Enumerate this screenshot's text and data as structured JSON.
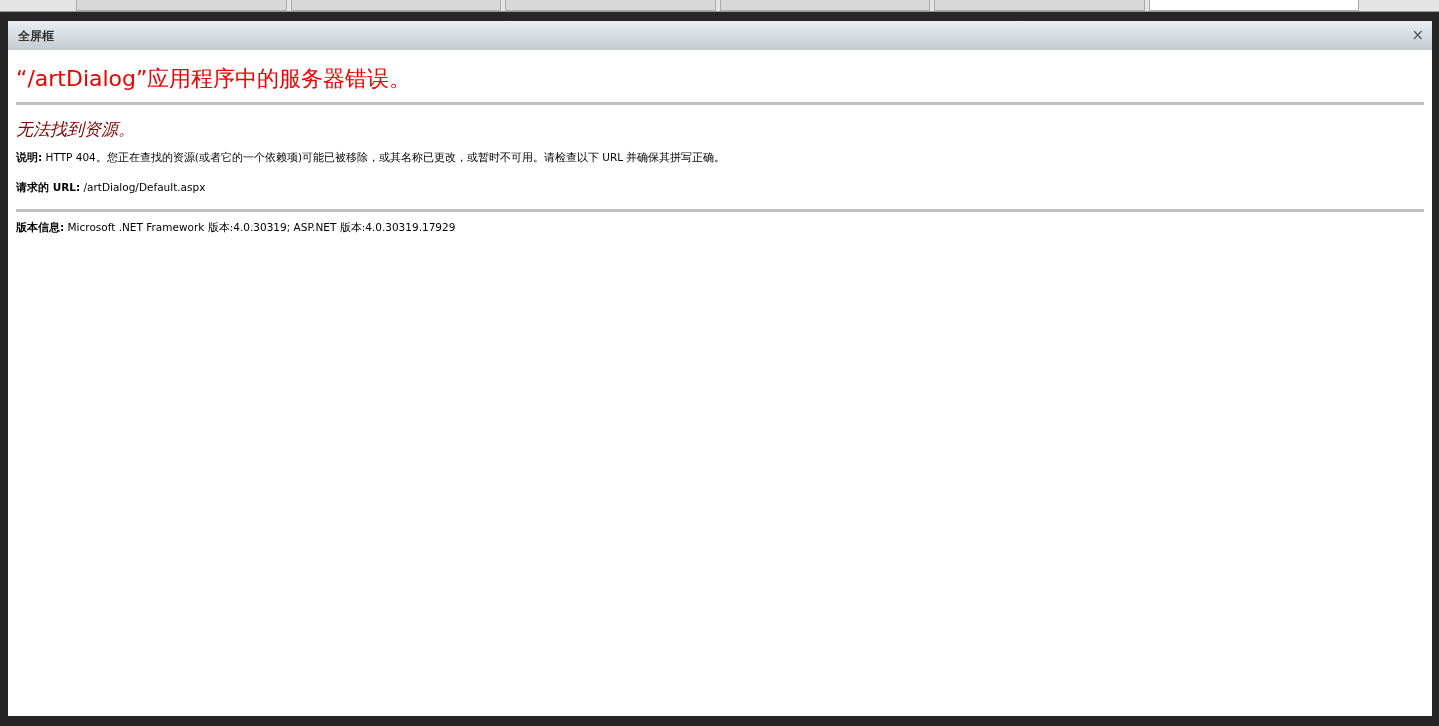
{
  "browser_tabs": [
    {
      "selected": false
    },
    {
      "selected": false
    },
    {
      "selected": false
    },
    {
      "selected": false
    },
    {
      "selected": false
    },
    {
      "selected": true
    }
  ],
  "dialog": {
    "title": "全屏框",
    "close": "×"
  },
  "error_page": {
    "heading": "“/artDialog”应用程序中的服务器错误。",
    "subheading": "无法找到资源。",
    "paragraphs": [
      "**说明:** HTTP 404。您正在查找的资源(或者它的一个依赖项)可能已被移除，或其名称已更改，或暂时不可用。请检查以下 URL 并确保其拼写正确。",
      "**请求的 URL:** /artDialog/Default.aspx"
    ],
    "version": "**版本信息:** Microsoft .NET Framework 版本:4.0.30319; ASP.NET 版本:4.0.30319.17929"
  }
}
